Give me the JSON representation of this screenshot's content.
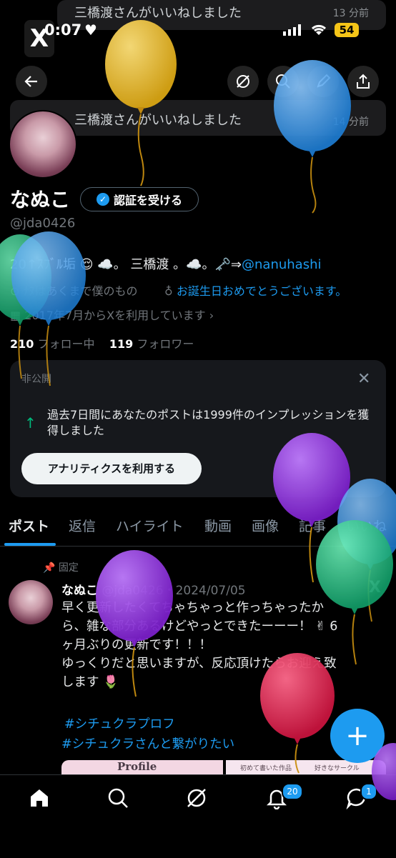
{
  "notifications": [
    {
      "text": "三橋渡さんがいいねしました",
      "time": "13 分前"
    },
    {
      "text": "三橋渡さんがいいねしました",
      "time": "14 分前"
    }
  ],
  "status_bar": {
    "time": "0:07",
    "battery": "54"
  },
  "profile": {
    "name": "なぬこ",
    "verify_label": "認証を受ける",
    "handle": "@jda0426",
    "bio_prefix": "20↑ｽﾌﾞﾙ垢",
    "bio_middle": "三橋渡",
    "bio_link": "@nanuhashi",
    "location": "ﾅﾇはあくまで僕のもの",
    "birthday_text": "お誕生日おめでとうございます。",
    "joined": "2017年7月からXを利用しています",
    "following_count": "210",
    "following_label": "フォロー中",
    "followers_count": "119",
    "followers_label": "フォロワー"
  },
  "analytics_card": {
    "private_label": "非公開",
    "message": "過去7日間にあなたのポストは1999件のインプレッションを獲得しました",
    "button_label": "アナリティクスを利用する"
  },
  "tabs": [
    "ポスト",
    "返信",
    "ハイライト",
    "動画",
    "画像",
    "記事",
    "いいね"
  ],
  "active_tab": "ポスト",
  "pinned_post": {
    "pinned_label": "固定",
    "author": "なぬこ",
    "handle_date": "@jda0426・2024/07/05",
    "text_lines": [
      "早く更新したくてちゃちゃっと作っちゃったか",
      "ら、雑な部分あるけどやっとできたーーー！ ✌ 6",
      "ヶ月ぶりの更新です！！！",
      "ゆっくりだと思いますが、反応頂けたらお迎え致",
      "します 🌷"
    ],
    "hashtags": [
      "#シチュクラプロフ",
      "#シチュクラさんと繋がりたい"
    ],
    "image_labels": [
      "Profile",
      "初めて書いた作品",
      "好きなサークル"
    ]
  },
  "bottom_nav": {
    "notifications_badge": "20",
    "messages_badge": "1"
  },
  "colors": {
    "accent": "#1d9bf0",
    "background": "#000000",
    "balloon_yellow": "#e8b92c",
    "balloon_blue": "#2f8fe0",
    "balloon_green": "#1fb07a",
    "balloon_purple": "#8a2bd6",
    "balloon_red": "#d8224a"
  }
}
